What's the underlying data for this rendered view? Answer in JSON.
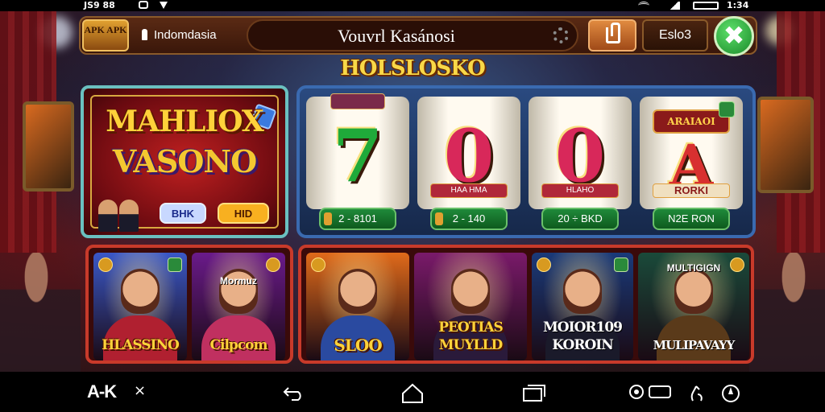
{
  "status_bar": {
    "left_text": "JS9 88",
    "right_text": "1:34"
  },
  "app": {
    "logo_text": "APK APK",
    "region": "Indomdasia",
    "search": {
      "value": "Vouvrl Kasánosi"
    },
    "lang_button": "Eslo3",
    "close_symbol": "✖"
  },
  "section_title": "HOLSLOSKO",
  "featured": {
    "title_line1": "MAHLIOX",
    "title_line2": "VASONO",
    "btn_a": "BHK",
    "btn_b": "HID"
  },
  "slot": {
    "reels": [
      {
        "symbol": "7",
        "color": "#1faa3a",
        "ribbon": "",
        "sign": ""
      },
      {
        "symbol": "0",
        "color": "#d8285a",
        "ribbon": "HAA HMA",
        "sign": ""
      },
      {
        "symbol": "0",
        "color": "#d8285a",
        "ribbon": "HLAHO",
        "sign": ""
      },
      {
        "symbol": "A",
        "color": "#d83030",
        "ribbon": "",
        "sign": "ARAIAOI",
        "bottom": "RORKI"
      }
    ],
    "bets": [
      "2 - 8101",
      "2 - 140",
      "20 ÷ BKD",
      "N2E RON"
    ]
  },
  "games_left": [
    {
      "label": "HLASSINO",
      "sublabel": "",
      "bg": "#3a58c8",
      "body": "#b02030"
    },
    {
      "label": "Cilpcom",
      "sublabel": "Mormuz",
      "bg": "#6a1a8a",
      "body": "#c03060"
    }
  ],
  "games_right": [
    {
      "label": "SLOO",
      "sublabel": "",
      "bg": "#e06a1a",
      "body": "#2a4aa0"
    },
    {
      "label": "PEOTIAS MUYLLD",
      "sublabel": "",
      "bg": "#7a1a6a",
      "body": "#2a1a3a"
    },
    {
      "label": "MOIOR109 KOROIN",
      "sublabel": "",
      "bg": "#1a3a7a",
      "body": "#1a1a2a"
    },
    {
      "label": "MULIPAVAYY",
      "sublabel": "MULTIGIGN",
      "bg": "#1a4a3a",
      "body": "#5a3a1a"
    }
  ],
  "nav_bar": {
    "brand": "A-K",
    "close": "×"
  }
}
